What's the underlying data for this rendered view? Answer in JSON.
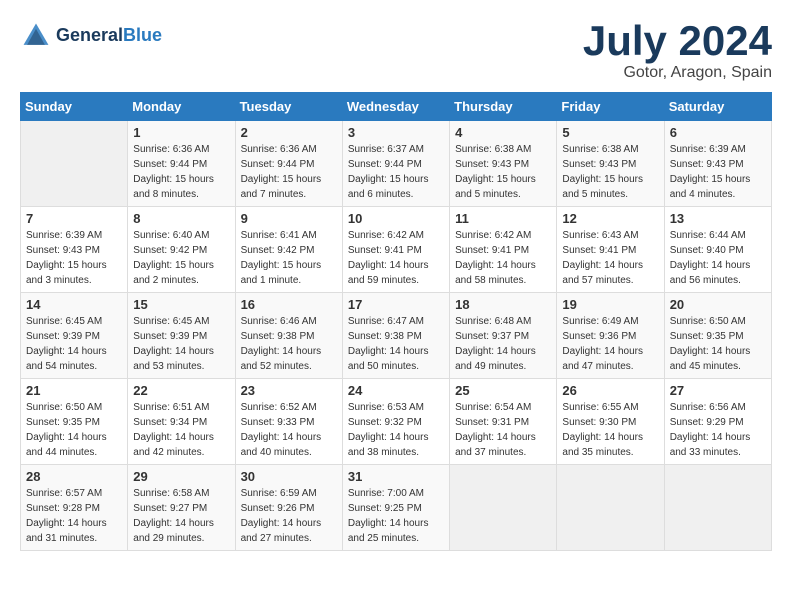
{
  "header": {
    "logo": {
      "line1": "General",
      "line2": "Blue"
    },
    "month": "July 2024",
    "location": "Gotor, Aragon, Spain"
  },
  "weekdays": [
    "Sunday",
    "Monday",
    "Tuesday",
    "Wednesday",
    "Thursday",
    "Friday",
    "Saturday"
  ],
  "weeks": [
    [
      {
        "day": "",
        "sunrise": "",
        "sunset": "",
        "daylight": ""
      },
      {
        "day": "1",
        "sunrise": "Sunrise: 6:36 AM",
        "sunset": "Sunset: 9:44 PM",
        "daylight": "Daylight: 15 hours and 8 minutes."
      },
      {
        "day": "2",
        "sunrise": "Sunrise: 6:36 AM",
        "sunset": "Sunset: 9:44 PM",
        "daylight": "Daylight: 15 hours and 7 minutes."
      },
      {
        "day": "3",
        "sunrise": "Sunrise: 6:37 AM",
        "sunset": "Sunset: 9:44 PM",
        "daylight": "Daylight: 15 hours and 6 minutes."
      },
      {
        "day": "4",
        "sunrise": "Sunrise: 6:38 AM",
        "sunset": "Sunset: 9:43 PM",
        "daylight": "Daylight: 15 hours and 5 minutes."
      },
      {
        "day": "5",
        "sunrise": "Sunrise: 6:38 AM",
        "sunset": "Sunset: 9:43 PM",
        "daylight": "Daylight: 15 hours and 5 minutes."
      },
      {
        "day": "6",
        "sunrise": "Sunrise: 6:39 AM",
        "sunset": "Sunset: 9:43 PM",
        "daylight": "Daylight: 15 hours and 4 minutes."
      }
    ],
    [
      {
        "day": "7",
        "sunrise": "Sunrise: 6:39 AM",
        "sunset": "Sunset: 9:43 PM",
        "daylight": "Daylight: 15 hours and 3 minutes."
      },
      {
        "day": "8",
        "sunrise": "Sunrise: 6:40 AM",
        "sunset": "Sunset: 9:42 PM",
        "daylight": "Daylight: 15 hours and 2 minutes."
      },
      {
        "day": "9",
        "sunrise": "Sunrise: 6:41 AM",
        "sunset": "Sunset: 9:42 PM",
        "daylight": "Daylight: 15 hours and 1 minute."
      },
      {
        "day": "10",
        "sunrise": "Sunrise: 6:42 AM",
        "sunset": "Sunset: 9:41 PM",
        "daylight": "Daylight: 14 hours and 59 minutes."
      },
      {
        "day": "11",
        "sunrise": "Sunrise: 6:42 AM",
        "sunset": "Sunset: 9:41 PM",
        "daylight": "Daylight: 14 hours and 58 minutes."
      },
      {
        "day": "12",
        "sunrise": "Sunrise: 6:43 AM",
        "sunset": "Sunset: 9:41 PM",
        "daylight": "Daylight: 14 hours and 57 minutes."
      },
      {
        "day": "13",
        "sunrise": "Sunrise: 6:44 AM",
        "sunset": "Sunset: 9:40 PM",
        "daylight": "Daylight: 14 hours and 56 minutes."
      }
    ],
    [
      {
        "day": "14",
        "sunrise": "Sunrise: 6:45 AM",
        "sunset": "Sunset: 9:39 PM",
        "daylight": "Daylight: 14 hours and 54 minutes."
      },
      {
        "day": "15",
        "sunrise": "Sunrise: 6:45 AM",
        "sunset": "Sunset: 9:39 PM",
        "daylight": "Daylight: 14 hours and 53 minutes."
      },
      {
        "day": "16",
        "sunrise": "Sunrise: 6:46 AM",
        "sunset": "Sunset: 9:38 PM",
        "daylight": "Daylight: 14 hours and 52 minutes."
      },
      {
        "day": "17",
        "sunrise": "Sunrise: 6:47 AM",
        "sunset": "Sunset: 9:38 PM",
        "daylight": "Daylight: 14 hours and 50 minutes."
      },
      {
        "day": "18",
        "sunrise": "Sunrise: 6:48 AM",
        "sunset": "Sunset: 9:37 PM",
        "daylight": "Daylight: 14 hours and 49 minutes."
      },
      {
        "day": "19",
        "sunrise": "Sunrise: 6:49 AM",
        "sunset": "Sunset: 9:36 PM",
        "daylight": "Daylight: 14 hours and 47 minutes."
      },
      {
        "day": "20",
        "sunrise": "Sunrise: 6:50 AM",
        "sunset": "Sunset: 9:35 PM",
        "daylight": "Daylight: 14 hours and 45 minutes."
      }
    ],
    [
      {
        "day": "21",
        "sunrise": "Sunrise: 6:50 AM",
        "sunset": "Sunset: 9:35 PM",
        "daylight": "Daylight: 14 hours and 44 minutes."
      },
      {
        "day": "22",
        "sunrise": "Sunrise: 6:51 AM",
        "sunset": "Sunset: 9:34 PM",
        "daylight": "Daylight: 14 hours and 42 minutes."
      },
      {
        "day": "23",
        "sunrise": "Sunrise: 6:52 AM",
        "sunset": "Sunset: 9:33 PM",
        "daylight": "Daylight: 14 hours and 40 minutes."
      },
      {
        "day": "24",
        "sunrise": "Sunrise: 6:53 AM",
        "sunset": "Sunset: 9:32 PM",
        "daylight": "Daylight: 14 hours and 38 minutes."
      },
      {
        "day": "25",
        "sunrise": "Sunrise: 6:54 AM",
        "sunset": "Sunset: 9:31 PM",
        "daylight": "Daylight: 14 hours and 37 minutes."
      },
      {
        "day": "26",
        "sunrise": "Sunrise: 6:55 AM",
        "sunset": "Sunset: 9:30 PM",
        "daylight": "Daylight: 14 hours and 35 minutes."
      },
      {
        "day": "27",
        "sunrise": "Sunrise: 6:56 AM",
        "sunset": "Sunset: 9:29 PM",
        "daylight": "Daylight: 14 hours and 33 minutes."
      }
    ],
    [
      {
        "day": "28",
        "sunrise": "Sunrise: 6:57 AM",
        "sunset": "Sunset: 9:28 PM",
        "daylight": "Daylight: 14 hours and 31 minutes."
      },
      {
        "day": "29",
        "sunrise": "Sunrise: 6:58 AM",
        "sunset": "Sunset: 9:27 PM",
        "daylight": "Daylight: 14 hours and 29 minutes."
      },
      {
        "day": "30",
        "sunrise": "Sunrise: 6:59 AM",
        "sunset": "Sunset: 9:26 PM",
        "daylight": "Daylight: 14 hours and 27 minutes."
      },
      {
        "day": "31",
        "sunrise": "Sunrise: 7:00 AM",
        "sunset": "Sunset: 9:25 PM",
        "daylight": "Daylight: 14 hours and 25 minutes."
      },
      {
        "day": "",
        "sunrise": "",
        "sunset": "",
        "daylight": ""
      },
      {
        "day": "",
        "sunrise": "",
        "sunset": "",
        "daylight": ""
      },
      {
        "day": "",
        "sunrise": "",
        "sunset": "",
        "daylight": ""
      }
    ]
  ]
}
